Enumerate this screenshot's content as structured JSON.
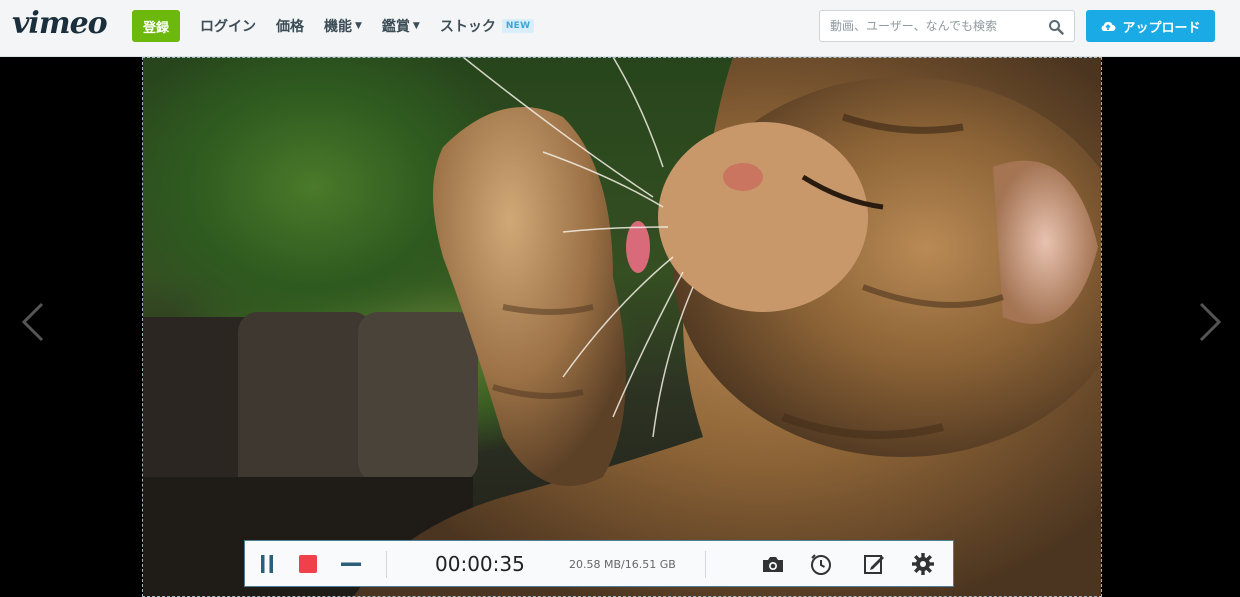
{
  "header": {
    "logo": "vimeo",
    "join_label": "登録",
    "nav": [
      {
        "label": "ログイン",
        "has_menu": false
      },
      {
        "label": "価格",
        "has_menu": false
      },
      {
        "label": "機能",
        "has_menu": true
      },
      {
        "label": "鑑賞",
        "has_menu": true
      },
      {
        "label": "ストック",
        "has_menu": false,
        "badge": "NEW"
      }
    ],
    "search_placeholder": "動画、ユーザー、なんでも検索",
    "upload_label": "アップロード"
  },
  "recorder": {
    "elapsed": "00:00:35",
    "size": "20.58 MB/16.51 GB",
    "icons": [
      "pause-icon",
      "stop-icon",
      "minimize-icon",
      "camera-icon",
      "clock-icon",
      "edit-icon",
      "gear-icon"
    ]
  },
  "colors": {
    "join": "#6cb80c",
    "upload": "#1aaae6",
    "stop": "#f0404a",
    "recorder_icon": "#2b5f7a"
  }
}
